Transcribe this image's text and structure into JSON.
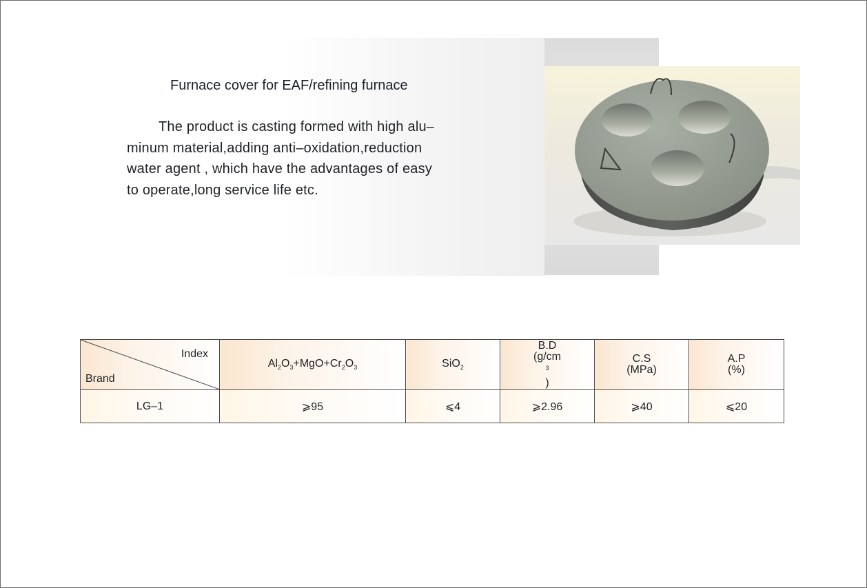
{
  "product": {
    "title": "Furnace cover for EAF/refining furnace",
    "description_lines": [
      "The product is casting formed with high alu–",
      "minum material,adding anti–oxidation,reduction",
      "water agent , which have the advantages of easy",
      "to operate,long service life etc."
    ]
  },
  "table": {
    "corner": {
      "index_label": "Index",
      "brand_label": "Brand"
    },
    "columns": {
      "composition": {
        "parts": [
          "Al",
          "2",
          "O",
          "3",
          "+MgO+Cr",
          "2",
          "O",
          "3"
        ]
      },
      "sio2": {
        "parts": [
          "SiO",
          "2"
        ]
      },
      "bd": {
        "line1": "B.D",
        "line2_pre": "(g/cm",
        "line2_sup": "3",
        "line2_post": ")"
      },
      "cs": {
        "line1": "C.S",
        "line2": "(MPa)"
      },
      "ap": {
        "line1": "A.P",
        "line2": "(%)"
      }
    },
    "rows": [
      {
        "brand": "LG–1",
        "composition": "⩾95",
        "sio2": "⩽4",
        "bd": "⩾2.96",
        "cs": "⩾40",
        "ap": "⩽20"
      }
    ]
  }
}
